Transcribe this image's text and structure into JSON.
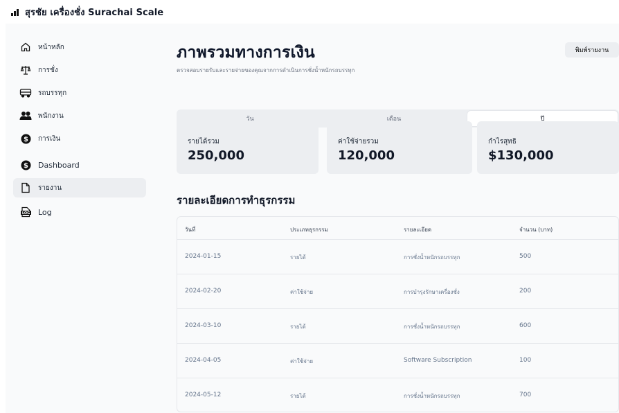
{
  "app": {
    "brand": "สุรชัย เครื่องชั่ง Surachai Scale"
  },
  "sidebar": {
    "items": [
      {
        "label": "หน้าหลัก",
        "icon": "home-icon"
      },
      {
        "label": "การชั่ง",
        "icon": "scale-icon"
      },
      {
        "label": "รถบรรทุก",
        "icon": "truck-icon"
      },
      {
        "label": "พนักงาน",
        "icon": "users-icon"
      },
      {
        "label": "การเงิน",
        "icon": "dollar-icon"
      },
      {
        "label": "Dashboard",
        "icon": "dollar-icon"
      },
      {
        "label": "รายงาน",
        "icon": "file-icon"
      },
      {
        "label": "Log",
        "icon": "log-icon"
      }
    ],
    "log_icon_text": "LOG"
  },
  "header": {
    "title": "ภาพรวมทางการเงิน",
    "subtitle": "ตรวจสอบรายรับและรายจ่ายของคุณจากการดำเนินการชั่งน้ำหนักรถบรรทุก",
    "print_label": "พิมพ์รายงาน"
  },
  "tabs": [
    {
      "label": "วัน"
    },
    {
      "label": "เดือน"
    },
    {
      "label": "ปี"
    }
  ],
  "cards": [
    {
      "label": "รายได้รวม",
      "value": "250,000"
    },
    {
      "label": "ค่าใช้จ่ายรวม",
      "value": "120,000"
    },
    {
      "label": "กำไรสุทธิ",
      "value": "$130,000"
    }
  ],
  "transactions": {
    "title": "รายละเอียดการทำธุรกรรม",
    "columns": [
      "วันที่",
      "ประเภทธุรกรรม",
      "รายละเอียด",
      "จำนวน (บาท)"
    ],
    "rows": [
      {
        "date": "2024-01-15",
        "type": "รายได้",
        "detail": "การชั่งน้ำหนักรถบรรทุก",
        "amount": "500"
      },
      {
        "date": "2024-02-20",
        "type": "ค่าใช้จ่าย",
        "detail": "การบำรุงรักษาเครื่องชั่ง",
        "amount": "200"
      },
      {
        "date": "2024-03-10",
        "type": "รายได้",
        "detail": "การชั่งน้ำหนักรถบรรทุก",
        "amount": "600"
      },
      {
        "date": "2024-04-05",
        "type": "ค่าใช้จ่าย",
        "detail": "Software Subscription",
        "amount": "100"
      },
      {
        "date": "2024-05-12",
        "type": "รายได้",
        "detail": "การชั่งน้ำหนักรถบรรทุก",
        "amount": "700"
      }
    ]
  },
  "colors": {
    "page": "#f9fafb",
    "panel": "#eceef1",
    "muted": "#64748b"
  }
}
